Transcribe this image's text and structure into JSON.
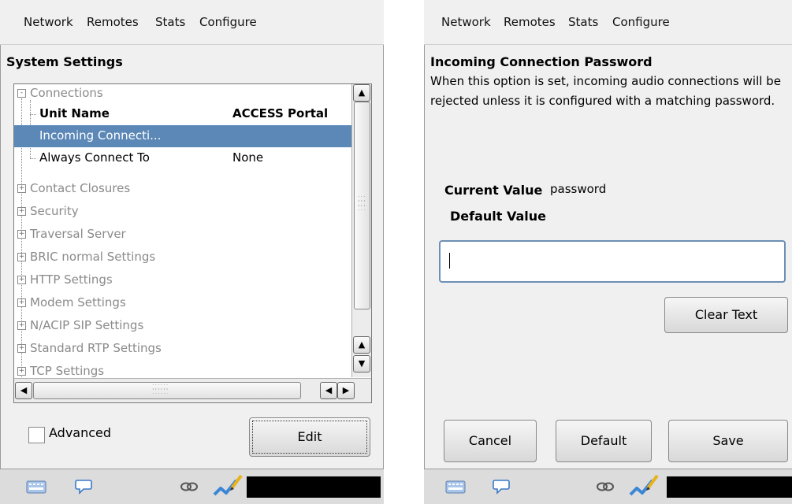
{
  "left": {
    "menu": [
      "Network",
      "Remotes",
      "Stats",
      "Configure"
    ],
    "heading": "System Settings",
    "tree": [
      {
        "label": "Connections",
        "value": "",
        "expander": "-"
      },
      {
        "label": "Unit Name",
        "value": "ACCESS Portal",
        "expander": ""
      },
      {
        "label": "Incoming Connecti...",
        "value": "",
        "expander": ""
      },
      {
        "label": "Always Connect To",
        "value": "None",
        "expander": ""
      },
      {
        "label": "Contact Closures",
        "value": "",
        "expander": "+"
      },
      {
        "label": "Security",
        "value": "",
        "expander": "+"
      },
      {
        "label": "Traversal Server",
        "value": "",
        "expander": "+"
      },
      {
        "label": "BRIC normal Settings",
        "value": "",
        "expander": "+"
      },
      {
        "label": "HTTP Settings",
        "value": "",
        "expander": "+"
      },
      {
        "label": "Modem Settings",
        "value": "",
        "expander": "+"
      },
      {
        "label": "N/ACIP SIP Settings",
        "value": "",
        "expander": "+"
      },
      {
        "label": "Standard RTP Settings",
        "value": "",
        "expander": "+"
      },
      {
        "label": "TCP Settings",
        "value": "",
        "expander": "+"
      }
    ],
    "advanced_label": "Advanced",
    "advanced_checked": false,
    "edit_label": "Edit"
  },
  "right": {
    "menu": [
      "Network",
      "Remotes",
      "Stats",
      "Configure"
    ],
    "heading": "Incoming Connection Password",
    "description": "When this option is set, incoming audio connections will be rejected unless it is configured with a matching password.",
    "current_value_label": "Current Value",
    "current_value": "password",
    "default_value_label": "Default Value",
    "default_value": "",
    "input_value": "",
    "clear_text_label": "Clear Text",
    "cancel_label": "Cancel",
    "default_label": "Default",
    "save_label": "Save"
  },
  "status_icons": [
    "keyboard-icon",
    "chat-bubble-icon",
    "link-icon",
    "signal-pen-icon"
  ],
  "colors": {
    "selection": "#5b88b7",
    "input_border": "#6d8fb5",
    "signal": "#3a86d6",
    "pen": "#e9b21c"
  }
}
